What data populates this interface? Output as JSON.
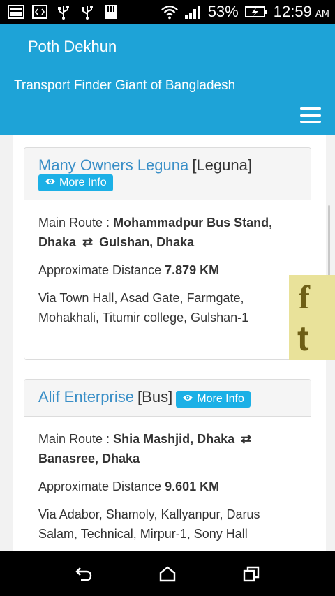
{
  "status_bar": {
    "battery_percent": "53%",
    "time": "12:59",
    "ampm": "AM",
    "icons": [
      "image-icon",
      "code-icon",
      "usb-icon",
      "usb-icon",
      "sd-card-icon",
      "wifi-icon",
      "signal-icon",
      "battery-charging-icon"
    ]
  },
  "header": {
    "title": "Poth Dekhun",
    "tagline": "Transport Finder Giant of Bangladesh"
  },
  "cards": [
    {
      "name": "Many Owners Leguna",
      "type": "[Leguna]",
      "more_info": "More Info",
      "route_label": "Main Route :",
      "route_from": "Mohammadpur Bus Stand, Dhaka",
      "route_to": "Gulshan, Dhaka",
      "distance_label": "Approximate Distance",
      "distance_value": "7.879 KM",
      "via": "Via Town Hall, Asad Gate, Farmgate, Mohakhali, Titumir college, Gulshan-1"
    },
    {
      "name": "Alif Enterprise",
      "type": "[Bus]",
      "more_info": "More Info",
      "route_label": "Main Route :",
      "route_from": "Shia Mashjid, Dhaka",
      "route_to": "Banasree, Dhaka",
      "distance_label": "Approximate Distance",
      "distance_value": "9.601 KM",
      "via": "Via Adabor, Shamoly, Kallyanpur, Darus Salam, Technical, Mirpur-1, Sony Hall"
    }
  ],
  "social": {
    "facebook_glyph": "f",
    "twitter_glyph": "t"
  },
  "colors": {
    "header": "#1ea3d7",
    "link": "#3a8fc7",
    "button": "#1cb0e6",
    "social_bg": "#e9e29a"
  }
}
